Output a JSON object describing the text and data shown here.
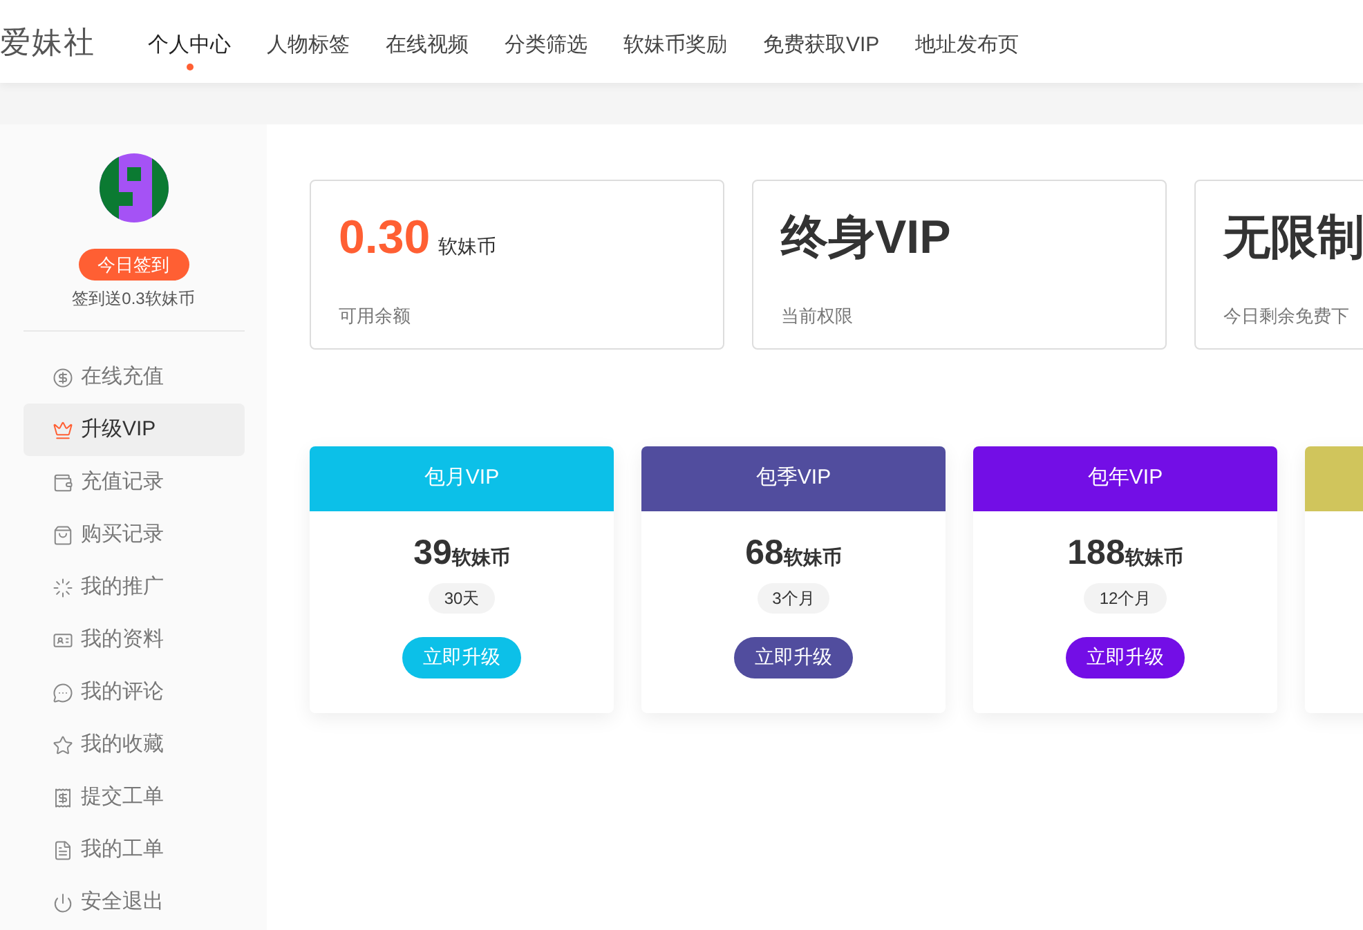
{
  "logo": "爱妹社",
  "nav": [
    {
      "label": "个人中心",
      "selected": true
    },
    {
      "label": "人物标签",
      "selected": false
    },
    {
      "label": "在线视频",
      "selected": false
    },
    {
      "label": "分类筛选",
      "selected": false
    },
    {
      "label": "软妹币奖励",
      "selected": false
    },
    {
      "label": "免费获取VIP",
      "selected": false
    },
    {
      "label": "地址发布页",
      "selected": false
    }
  ],
  "sidebar": {
    "checkin_button": "今日签到",
    "checkin_note": "签到送0.3软妹币",
    "items": [
      {
        "label": "在线充值",
        "selected": false
      },
      {
        "label": "升级VIP",
        "selected": true
      },
      {
        "label": "充值记录",
        "selected": false
      },
      {
        "label": "购买记录",
        "selected": false
      },
      {
        "label": "我的推广",
        "selected": false
      },
      {
        "label": "我的资料",
        "selected": false
      },
      {
        "label": "我的评论",
        "selected": false
      },
      {
        "label": "我的收藏",
        "selected": false
      },
      {
        "label": "提交工单",
        "selected": false
      },
      {
        "label": "我的工单",
        "selected": false
      },
      {
        "label": "安全退出",
        "selected": false
      }
    ]
  },
  "stats": [
    {
      "value": "0.30",
      "unit": "软妹币",
      "label": "可用余额",
      "highlight": true
    },
    {
      "value": "终身VIP",
      "label": "当前权限",
      "highlight": false
    },
    {
      "value": "无限制",
      "label": "今日剩余免费下",
      "highlight": false
    }
  ],
  "plans": [
    {
      "title": "包月VIP",
      "price": "39",
      "unit": "软妹币",
      "duration": "30天",
      "button": "立即升级",
      "color": "#0cc0e8"
    },
    {
      "title": "包季VIP",
      "price": "68",
      "unit": "软妹币",
      "duration": "3个月",
      "button": "立即升级",
      "color": "#514d9e"
    },
    {
      "title": "包年VIP",
      "price": "188",
      "unit": "软妹币",
      "duration": "12个月",
      "button": "立即升级",
      "color": "#730ee6"
    },
    {
      "color": "#d0c55c"
    }
  ]
}
